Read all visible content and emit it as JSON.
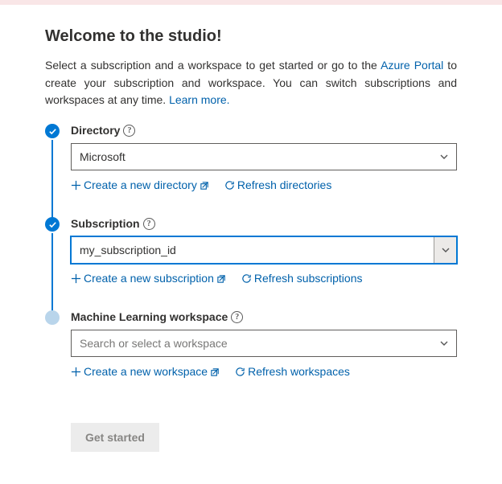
{
  "header": {
    "title": "Welcome to the studio!"
  },
  "intro": {
    "text_before": "Select a subscription and a workspace to get started or go to the ",
    "portal_link": "Azure Portal",
    "text_mid": " to create your subscription and workspace. You can switch subscriptions and workspaces at any time. ",
    "learn_more": "Learn more."
  },
  "steps": {
    "directory": {
      "label": "Directory",
      "value": "Microsoft",
      "create": "Create a new directory",
      "refresh": "Refresh directories"
    },
    "subscription": {
      "label": "Subscription",
      "value": "my_subscription_id",
      "create": "Create a new subscription",
      "refresh": "Refresh subscriptions"
    },
    "workspace": {
      "label": "Machine Learning workspace",
      "placeholder": "Search or select a workspace",
      "create": "Create a new workspace",
      "refresh": "Refresh workspaces"
    }
  },
  "footer": {
    "get_started": "Get started"
  },
  "colors": {
    "accent": "#0078d4",
    "link": "#0061ab"
  }
}
